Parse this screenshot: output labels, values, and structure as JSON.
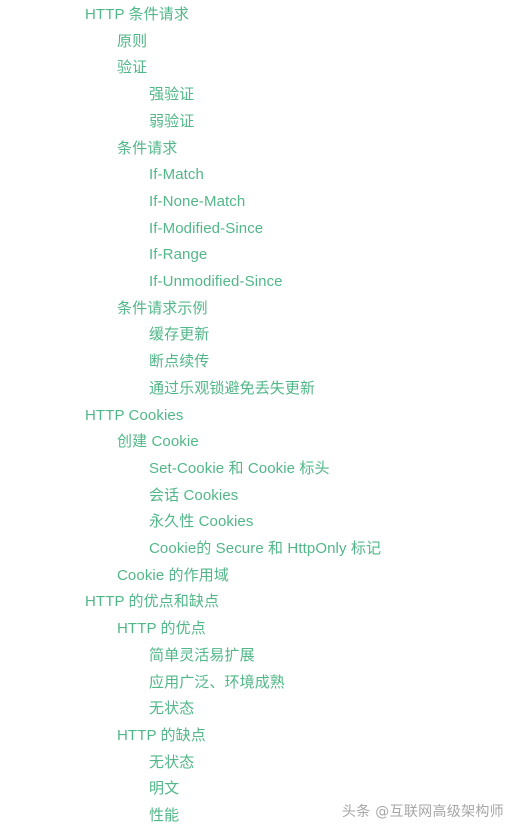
{
  "page": {
    "background_color": "#ffffff",
    "link_color": "#52b788",
    "watermark_color": "#9a9a9a"
  },
  "watermark": {
    "text": "头条 @互联网高级架构师"
  },
  "toc": {
    "items": [
      {
        "label": "HTTP 条件请求",
        "level": 0
      },
      {
        "label": "原则",
        "level": 1
      },
      {
        "label": "验证",
        "level": 1
      },
      {
        "label": "强验证",
        "level": 2
      },
      {
        "label": "弱验证",
        "level": 2
      },
      {
        "label": "条件请求",
        "level": 1
      },
      {
        "label": "If-Match",
        "level": 2
      },
      {
        "label": "If-None-Match",
        "level": 2
      },
      {
        "label": "If-Modified-Since",
        "level": 2
      },
      {
        "label": "If-Range",
        "level": 2
      },
      {
        "label": "If-Unmodified-Since",
        "level": 2
      },
      {
        "label": "条件请求示例",
        "level": 1
      },
      {
        "label": "缓存更新",
        "level": 2
      },
      {
        "label": "断点续传",
        "level": 2
      },
      {
        "label": "通过乐观锁避免丢失更新",
        "level": 2
      },
      {
        "label": "HTTP Cookies",
        "level": 0
      },
      {
        "label": "创建 Cookie",
        "level": 1
      },
      {
        "label": "Set-Cookie 和 Cookie 标头",
        "level": 2
      },
      {
        "label": "会话 Cookies",
        "level": 2
      },
      {
        "label": "永久性 Cookies",
        "level": 2
      },
      {
        "label": "Cookie的 Secure 和 HttpOnly 标记",
        "level": 2
      },
      {
        "label": "Cookie 的作用域",
        "level": 1
      },
      {
        "label": "HTTP 的优点和缺点",
        "level": 0
      },
      {
        "label": "HTTP 的优点",
        "level": 1
      },
      {
        "label": "简单灵活易扩展",
        "level": 2
      },
      {
        "label": "应用广泛、环境成熟",
        "level": 2
      },
      {
        "label": "无状态",
        "level": 2
      },
      {
        "label": "HTTP 的缺点",
        "level": 1
      },
      {
        "label": "无状态",
        "level": 2
      },
      {
        "label": "明文",
        "level": 2
      },
      {
        "label": "性能",
        "level": 2
      }
    ]
  }
}
